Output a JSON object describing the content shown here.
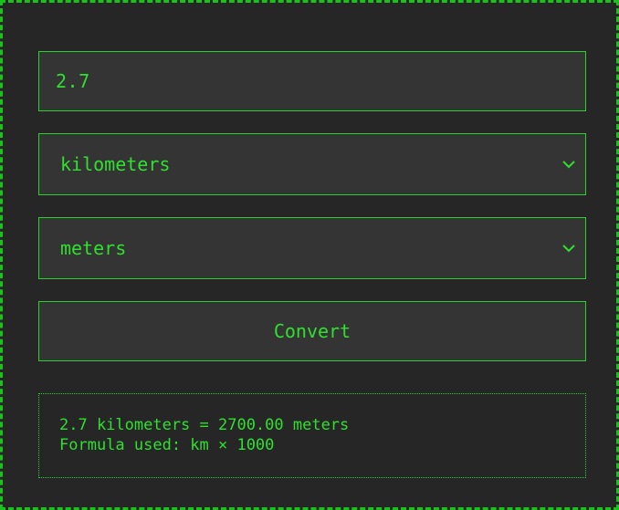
{
  "converter": {
    "value_input": {
      "value": "2.7",
      "placeholder": ""
    },
    "from_unit": {
      "selected": "kilometers",
      "icon": "chevron-down-icon"
    },
    "to_unit": {
      "selected": "meters",
      "icon": "chevron-down-icon"
    },
    "convert_button": {
      "label": "Convert"
    },
    "result": {
      "line1": "2.7 kilometers = 2700.00 meters",
      "line2": "Formula used: km × 1000"
    }
  },
  "colors": {
    "accent": "#2fe02f",
    "border": "#2fcf2f",
    "panel_bg": "#262626",
    "field_bg": "#343434"
  }
}
